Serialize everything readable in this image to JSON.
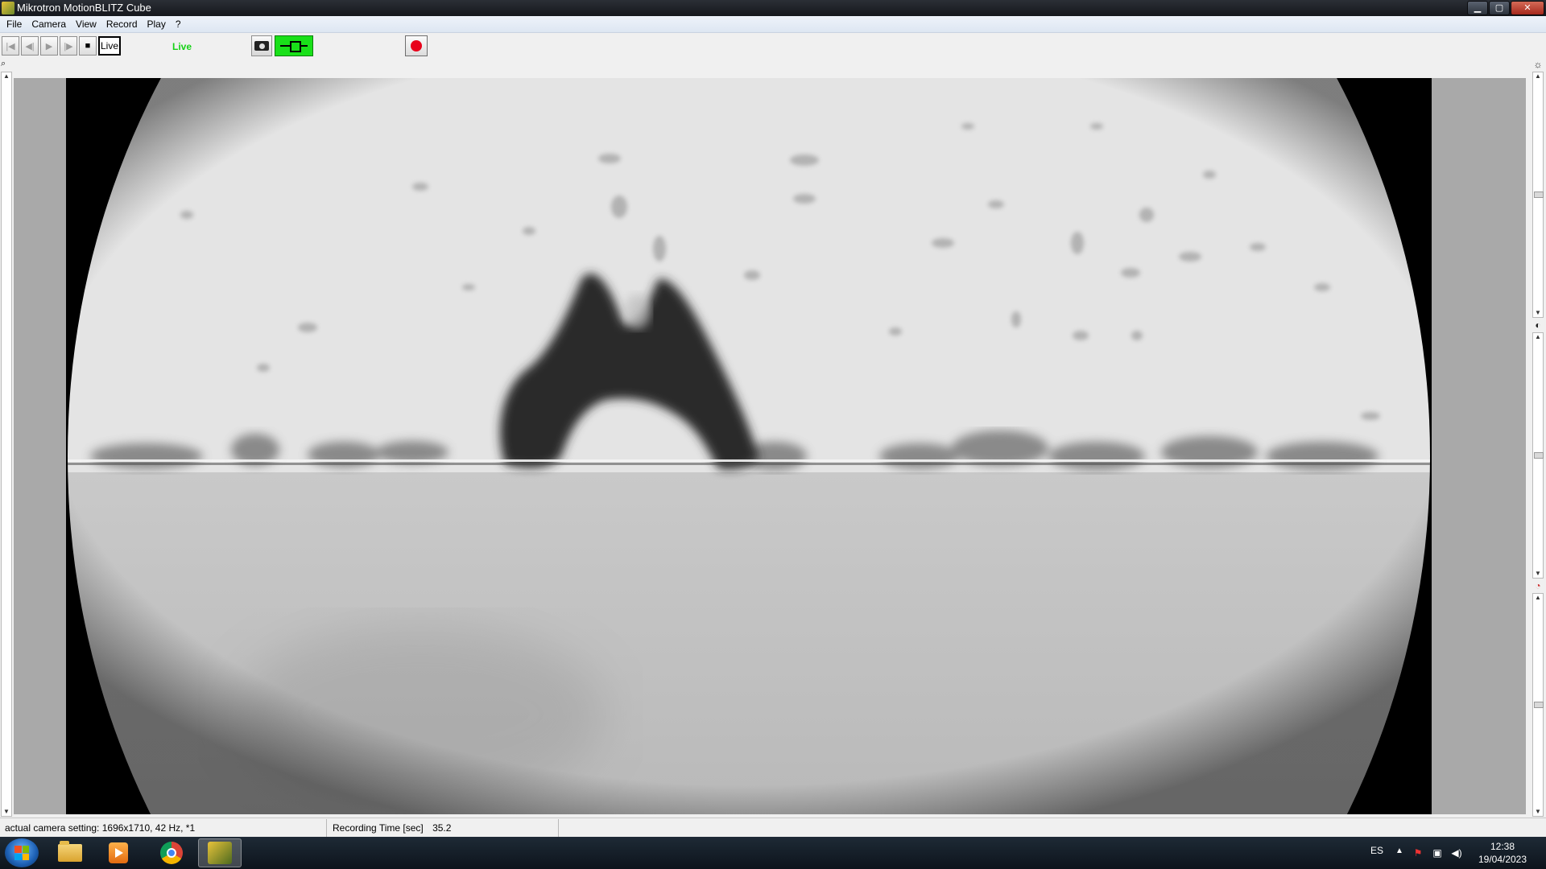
{
  "window": {
    "title": "Mikrotron MotionBLITZ Cube",
    "controls": {
      "minimize": "▁",
      "maximize": "▢",
      "close": "✕"
    }
  },
  "menu": {
    "items": [
      "File",
      "Camera",
      "View",
      "Record",
      "Play",
      "?"
    ]
  },
  "toolbar": {
    "live_button_label": "Live",
    "live_indicator_text": "Live",
    "live_indicator_color": "#16d116",
    "record_color": "#e8001a",
    "trigger_color": "#19e019"
  },
  "status_bar": {
    "camera_setting_text": "actual camera setting:  1696x1710, 42 Hz, *1",
    "recording_time_label": "Recording Time [sec]",
    "recording_time_value": "35.2"
  },
  "taskbar": {
    "language": "ES",
    "time": "12:38",
    "date": "19/04/2023",
    "apps": [
      "windows-explorer",
      "media-player",
      "chrome",
      "mikrotron-motionblitz"
    ]
  }
}
